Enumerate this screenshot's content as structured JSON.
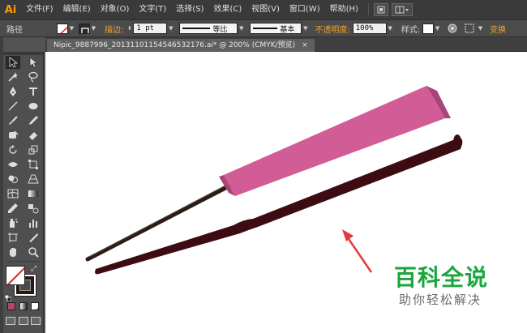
{
  "app": {
    "logo": "Ai"
  },
  "menu": {
    "items": [
      "文件(F)",
      "编辑(E)",
      "对象(O)",
      "文字(T)",
      "选择(S)",
      "效果(C)",
      "视图(V)",
      "窗口(W)",
      "帮助(H)"
    ]
  },
  "control_bar": {
    "selection_label": "路径",
    "stroke_label": "描边:",
    "stroke_weight": "1 pt",
    "profile_label": "等比",
    "brush_label": "基本",
    "opacity_label": "不透明度:",
    "opacity_value": "100%",
    "style_label": "样式:",
    "extra_label": "变换"
  },
  "document": {
    "tab_title": "Nipic_9887996_20131101154546532176.ai* @ 200% (CMYK/预览)",
    "close_glyph": "×"
  },
  "colors": {
    "fan_light": "#d25c96",
    "fan_dark": "#a84578",
    "stick": "#2a1c16",
    "dark_stick": "#3d0c12",
    "arrow": "#e4393c",
    "watermark_green": "#1aa63d"
  },
  "watermark": {
    "main": "百科全说",
    "sub": "助你轻松解决"
  }
}
